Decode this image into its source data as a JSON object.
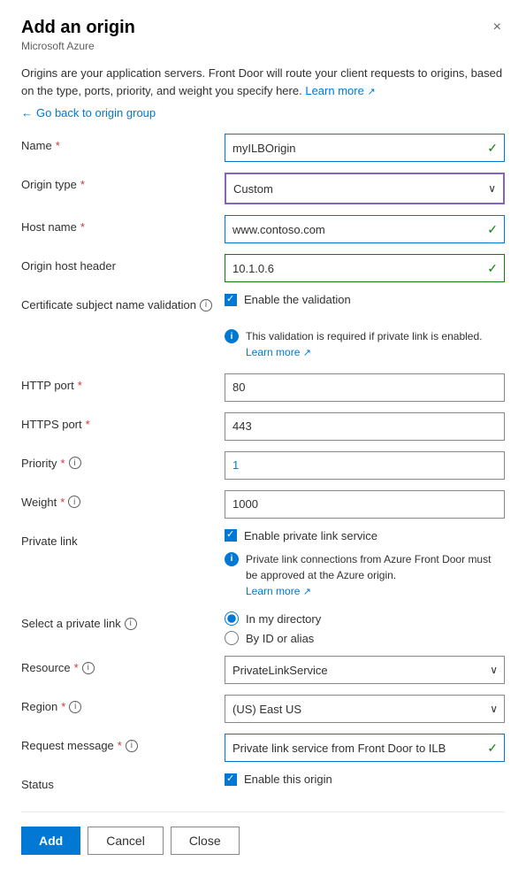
{
  "header": {
    "title": "Add an origin",
    "subtitle": "Microsoft Azure",
    "close_label": "×"
  },
  "description": {
    "text": "Origins are your application servers. Front Door will route your client requests to origins, based on the type, ports, priority, and weight you specify here.",
    "learn_more": "Learn more",
    "learn_more_url": "#"
  },
  "back_link": "Go back to origin group",
  "form": {
    "name_label": "Name",
    "name_value": "myILBOrigin",
    "origin_type_label": "Origin type",
    "origin_type_value": "Custom",
    "host_name_label": "Host name",
    "host_name_value": "www.contoso.com",
    "origin_host_header_label": "Origin host header",
    "origin_host_header_value": "10.1.0.6",
    "cert_validation_label": "Certificate subject name validation",
    "cert_validation_checkbox_label": "Enable the validation",
    "cert_validation_info": "This validation is required if private link is enabled.",
    "cert_validation_learn_more": "Learn more",
    "http_port_label": "HTTP port",
    "http_port_value": "80",
    "https_port_label": "HTTPS port",
    "https_port_value": "443",
    "priority_label": "Priority",
    "priority_value": "1",
    "weight_label": "Weight",
    "weight_value": "1000",
    "private_link_label": "Private link",
    "private_link_checkbox_label": "Enable private link service",
    "private_link_info": "Private link connections from Azure Front Door must be approved at the Azure origin.",
    "private_link_learn_more": "Learn more",
    "select_private_link_label": "Select a private link",
    "radio_in_my_directory": "In my directory",
    "radio_by_id": "By ID or alias",
    "resource_label": "Resource",
    "resource_value": "PrivateLinkService",
    "region_label": "Region",
    "region_value": "(US) East US",
    "request_message_label": "Request message",
    "request_message_value": "Private link service from Front Door to ILB",
    "status_label": "Status",
    "status_checkbox_label": "Enable this origin"
  },
  "footer": {
    "add_label": "Add",
    "cancel_label": "Cancel",
    "close_label": "Close"
  }
}
